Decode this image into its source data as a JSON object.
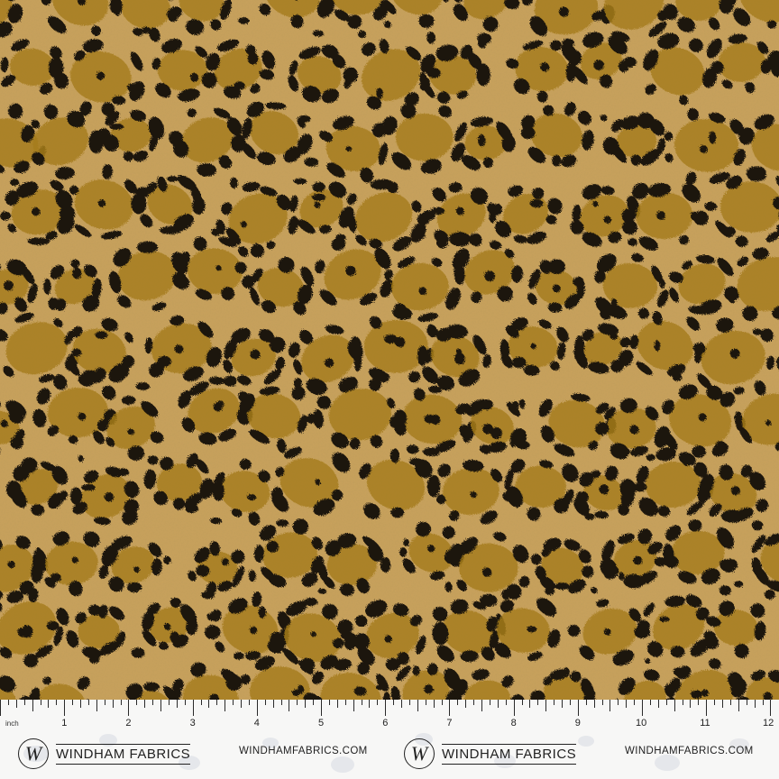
{
  "swatch": {
    "pattern": "leopard-print",
    "colors": {
      "base": "#c9a25c",
      "ochre": "#a67c1c",
      "spot": "#1c140c"
    }
  },
  "ruler": {
    "unit_label": "inch",
    "numbers": [
      "1",
      "2",
      "3",
      "4",
      "5",
      "6",
      "7",
      "8",
      "9",
      "10",
      "11",
      "12"
    ]
  },
  "branding": {
    "logo_letter": "W",
    "name": "WINDHAM FABRICS",
    "url": "WINDHAMFABRICS.COM"
  }
}
